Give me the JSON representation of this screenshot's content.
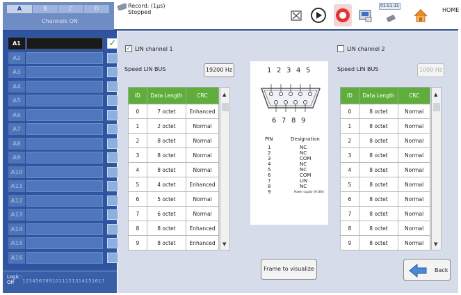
{
  "groups": {
    "tabs": [
      "A",
      "B",
      "C",
      "D"
    ],
    "selected": "A",
    "channels_on": "Channels ON"
  },
  "record": {
    "line1": "Record: (1µs)",
    "line2": "Stopped"
  },
  "time_display": "01:51:15",
  "home_label": "HOME",
  "channels": [
    "A1",
    "A2",
    "A3",
    "A4",
    "A5",
    "A6",
    "A7",
    "A8",
    "A9",
    "A10",
    "A11",
    "A12",
    "A13",
    "A14",
    "A15",
    "A16"
  ],
  "logic": {
    "label": "Logic : ",
    "state": "Off",
    "numbers": "1234567891011121314151617"
  },
  "lin1": {
    "label": "LIN channel 1",
    "checked": true,
    "speed_label": "Speed LIN BUS",
    "speed": "19200 Hz",
    "headers": [
      "ID",
      "Data Length",
      "CRC"
    ],
    "rows": [
      [
        "0",
        "7 octet",
        "Enhanced"
      ],
      [
        "1",
        "2 octet",
        "Normal"
      ],
      [
        "2",
        "8 octet",
        "Normal"
      ],
      [
        "3",
        "8 octet",
        "Normal"
      ],
      [
        "4",
        "8 octet",
        "Normal"
      ],
      [
        "5",
        "4 octet",
        "Enhanced"
      ],
      [
        "6",
        "5 octet",
        "Normal"
      ],
      [
        "7",
        "6 octet",
        "Normal"
      ],
      [
        "8",
        "8 octet",
        "Enhanced"
      ],
      [
        "9",
        "8 octet",
        "Enhanced"
      ]
    ]
  },
  "lin2": {
    "label": "LIN channel 2",
    "checked": false,
    "speed_label": "Speed LIN BUS",
    "speed": "1000 Hz",
    "headers": [
      "ID",
      "Data Length",
      "CRC"
    ],
    "rows": [
      [
        "0",
        "8 octet",
        "Normal"
      ],
      [
        "1",
        "8 octet",
        "Normal"
      ],
      [
        "2",
        "8 octet",
        "Normal"
      ],
      [
        "3",
        "8 octet",
        "Normal"
      ],
      [
        "4",
        "8 octet",
        "Normal"
      ],
      [
        "5",
        "8 octet",
        "Normal"
      ],
      [
        "6",
        "8 octet",
        "Normal"
      ],
      [
        "7",
        "8 octet",
        "Normal"
      ],
      [
        "8",
        "8 octet",
        "Normal"
      ],
      [
        "9",
        "8 octet",
        "Normal"
      ]
    ]
  },
  "connector": {
    "top_pins": [
      "1",
      "2",
      "3",
      "4",
      "5"
    ],
    "bottom_pins": [
      "6",
      "7",
      "8",
      "9"
    ],
    "header_pin": "PIN",
    "header_designation": "Designation",
    "pins": [
      [
        "1",
        "NC"
      ],
      [
        "2",
        "NC"
      ],
      [
        "3",
        "COM"
      ],
      [
        "4",
        "NC"
      ],
      [
        "5",
        "NC"
      ],
      [
        "6",
        "COM"
      ],
      [
        "7",
        "LIN"
      ],
      [
        "8",
        "NC"
      ],
      [
        "9",
        "Power supply (8-18V)"
      ]
    ]
  },
  "buttons": {
    "frame": "Frame to visualize",
    "back": "Back"
  },
  "colors": {
    "channel_panel": "#2f55a0",
    "table_header": "#5fae3c",
    "main_bg": "#d7dcea",
    "accent_border": "#2c4b86"
  }
}
